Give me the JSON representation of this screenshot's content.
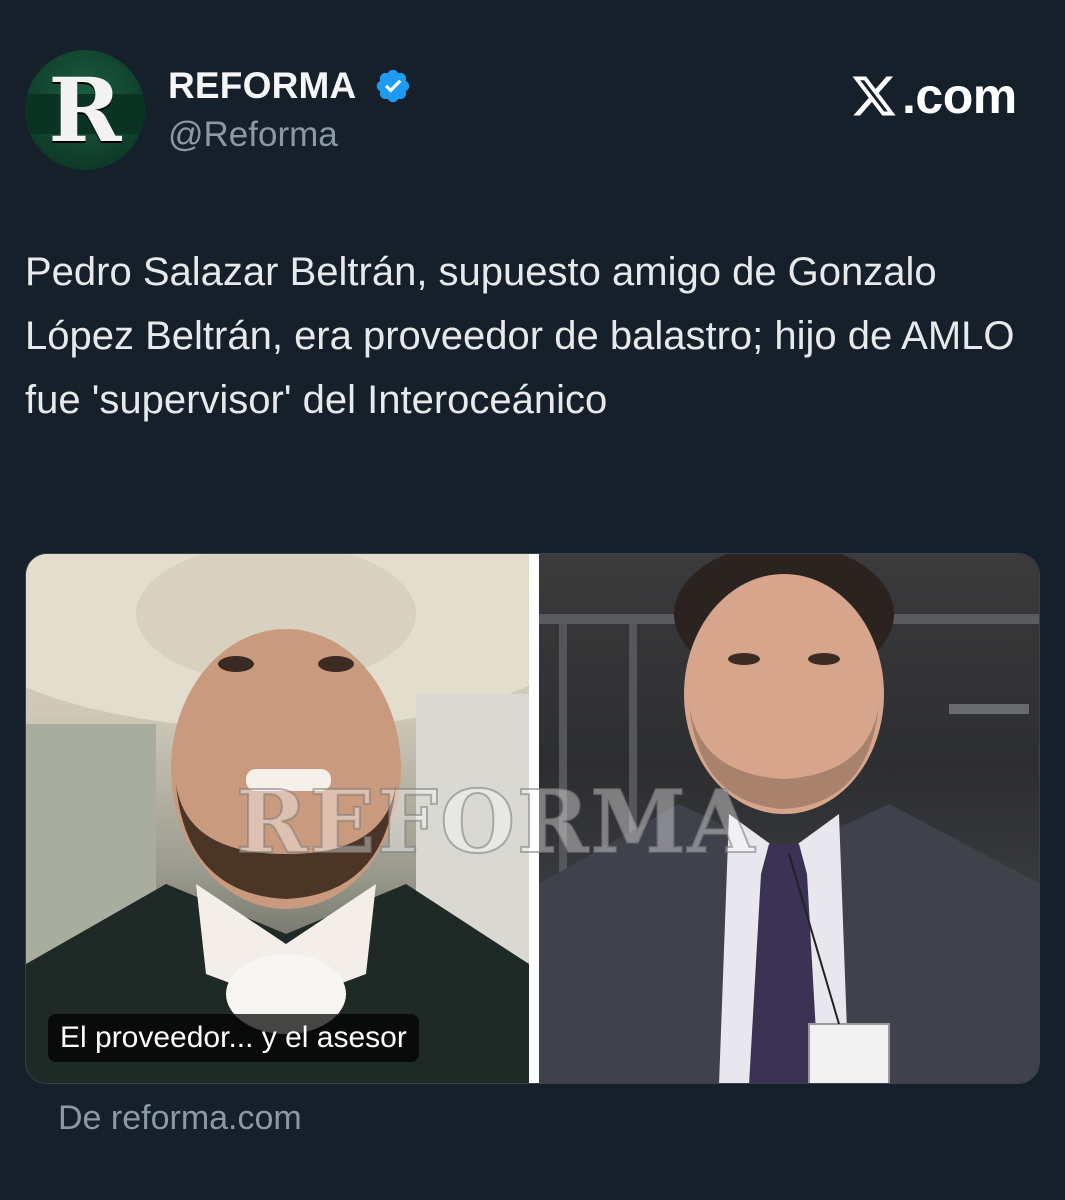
{
  "author": {
    "name": "REFORMA",
    "handle": "@Reforma",
    "avatar_letter": "R",
    "verified": true,
    "verified_color": "#1d9bf0"
  },
  "brand": {
    "label": ".com",
    "icon": "x-logo-icon"
  },
  "tweet": {
    "text": "Pedro Salazar Beltrán, supuesto amigo de Gonzalo López Beltrán, era proveedor de balastro; hijo de AMLO fue 'supervisor' del Interoceánico"
  },
  "media": {
    "watermark": "REFORMA",
    "caption": "El proveedor... y el asesor"
  },
  "card": {
    "source": "De reforma.com"
  },
  "colors": {
    "background": "#15202b",
    "text": "#e7e9ea",
    "muted": "#8b98a5",
    "accent": "#1d9bf0"
  }
}
